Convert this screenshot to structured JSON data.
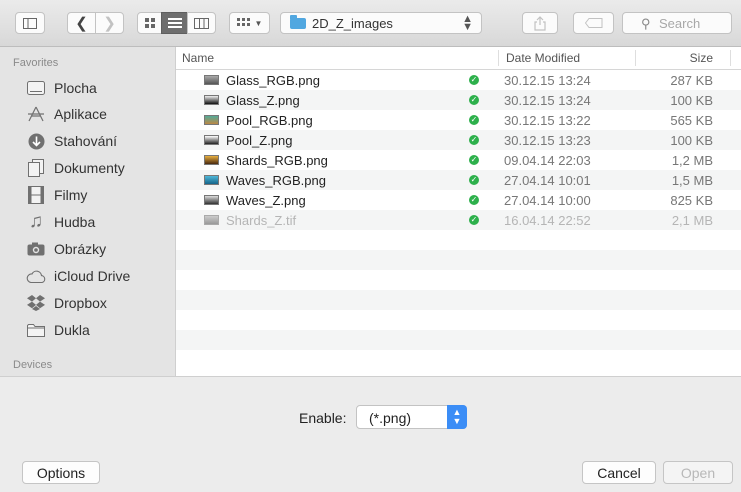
{
  "toolbar": {
    "folder_name": "2D_Z_images",
    "search_placeholder": "Search"
  },
  "sidebar": {
    "favorites_heading": "Favorites",
    "items": [
      {
        "label": "Plocha",
        "icon": "desktop-icon"
      },
      {
        "label": "Aplikace",
        "icon": "applications-icon"
      },
      {
        "label": "Stahování",
        "icon": "downloads-icon"
      },
      {
        "label": "Dokumenty",
        "icon": "documents-icon"
      },
      {
        "label": "Filmy",
        "icon": "movies-icon"
      },
      {
        "label": "Hudba",
        "icon": "music-icon"
      },
      {
        "label": "Obrázky",
        "icon": "pictures-icon"
      },
      {
        "label": "iCloud Drive",
        "icon": "cloud-icon"
      },
      {
        "label": "Dropbox",
        "icon": "dropbox-icon"
      },
      {
        "label": "Dukla",
        "icon": "folder-icon"
      }
    ],
    "devices_heading": "Devices"
  },
  "list": {
    "headers": {
      "name": "Name",
      "date": "Date Modified",
      "size": "Size"
    },
    "rows": [
      {
        "name": "Glass_RGB.png",
        "date": "30.12.15 13:24",
        "size": "287 KB",
        "enabled": true
      },
      {
        "name": "Glass_Z.png",
        "date": "30.12.15 13:24",
        "size": "100 KB",
        "enabled": true
      },
      {
        "name": "Pool_RGB.png",
        "date": "30.12.15 13:22",
        "size": "565 KB",
        "enabled": true
      },
      {
        "name": "Pool_Z.png",
        "date": "30.12.15 13:23",
        "size": "100 KB",
        "enabled": true
      },
      {
        "name": "Shards_RGB.png",
        "date": "09.04.14 22:03",
        "size": "1,2 MB",
        "enabled": true
      },
      {
        "name": "Waves_RGB.png",
        "date": "27.04.14 10:01",
        "size": "1,5 MB",
        "enabled": true
      },
      {
        "name": "Waves_Z.png",
        "date": "27.04.14 10:00",
        "size": "825 KB",
        "enabled": true
      },
      {
        "name": "Shards_Z.tif",
        "date": "16.04.14 22:52",
        "size": "2,1 MB",
        "enabled": false
      }
    ]
  },
  "bottom": {
    "enable_label": "Enable:",
    "filter_value": "(*.png)",
    "options_label": "Options",
    "cancel_label": "Cancel",
    "open_label": "Open"
  }
}
